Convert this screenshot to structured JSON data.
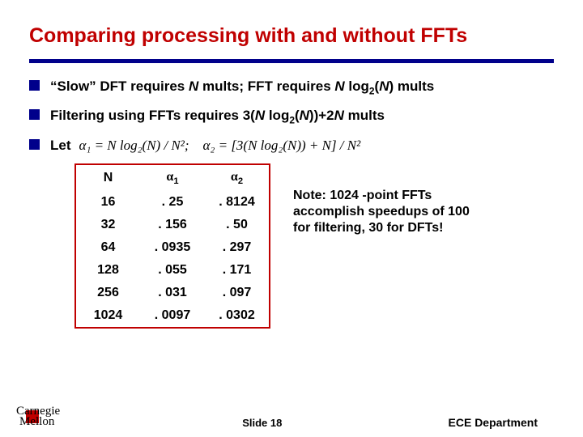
{
  "title": "Comparing processing with and without FFTs",
  "bullets": {
    "b1_pre": "“Slow” DFT requires ",
    "b1_mid1": "N",
    "b1_mid2": " mults; FFT requires ",
    "b1_mid3": "N",
    "b1_mid4": " log",
    "b1_sub": "2",
    "b1_mid5": "(",
    "b1_mid6": "N",
    "b1_mid7": ") mults",
    "b2_pre": "Filtering using FFTs requires 3(",
    "b2_m1": "N",
    "b2_m2": " log",
    "b2_sub": "2",
    "b2_m3": "(",
    "b2_m4": "N",
    "b2_m5": "))+2",
    "b2_m6": "N",
    "b2_m7": " mults",
    "b3_label": "Let",
    "formula": "α₁ = N log₂(N) / N²; α₂ = [3(N log₂(N)) + N] / N²"
  },
  "table": {
    "h1": "N",
    "h2_a": "α",
    "h2_s": "1",
    "h3_a": "α",
    "h3_s": "2",
    "rows": [
      {
        "n": "16",
        "a1": ". 25",
        "a2": ". 8124"
      },
      {
        "n": "32",
        "a1": ". 156",
        "a2": ". 50"
      },
      {
        "n": "64",
        "a1": ". 0935",
        "a2": ". 297"
      },
      {
        "n": "128",
        "a1": ". 055",
        "a2": ". 171"
      },
      {
        "n": "256",
        "a1": ". 031",
        "a2": ". 097"
      },
      {
        "n": "1024",
        "a1": ". 0097",
        "a2": ". 0302"
      }
    ]
  },
  "note_bold": "Note:",
  "note_rest": " 1024 -point FFTs accomplish speedups of 100 for filtering, 30 for DFTs!",
  "footer": {
    "logo_l1": "Carnegie",
    "logo_l2": "Mellon",
    "slide": "Slide 18",
    "dept": "ECE Department"
  }
}
